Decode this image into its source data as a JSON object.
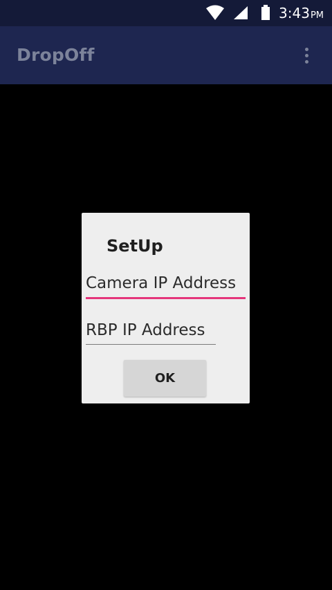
{
  "status_bar": {
    "time": "3:43",
    "ampm": "PM",
    "icons": [
      "wifi-icon",
      "cell-signal-icon",
      "battery-icon"
    ]
  },
  "app_bar": {
    "title": "DropOff",
    "menu_icon": "overflow-menu-icon"
  },
  "dialog": {
    "title": "SetUp",
    "camera_field": {
      "placeholder": "Camera IP Address",
      "value": ""
    },
    "rbp_field": {
      "placeholder": "RBP IP Address",
      "value": ""
    },
    "ok_label": "OK"
  },
  "colors": {
    "status_bar_bg": "#141a38",
    "app_bar_bg": "#1e2650",
    "app_title": "#7c839a",
    "dialog_bg": "#eeeeee",
    "focus_accent": "#e4347a",
    "screen_bg": "#000000"
  }
}
